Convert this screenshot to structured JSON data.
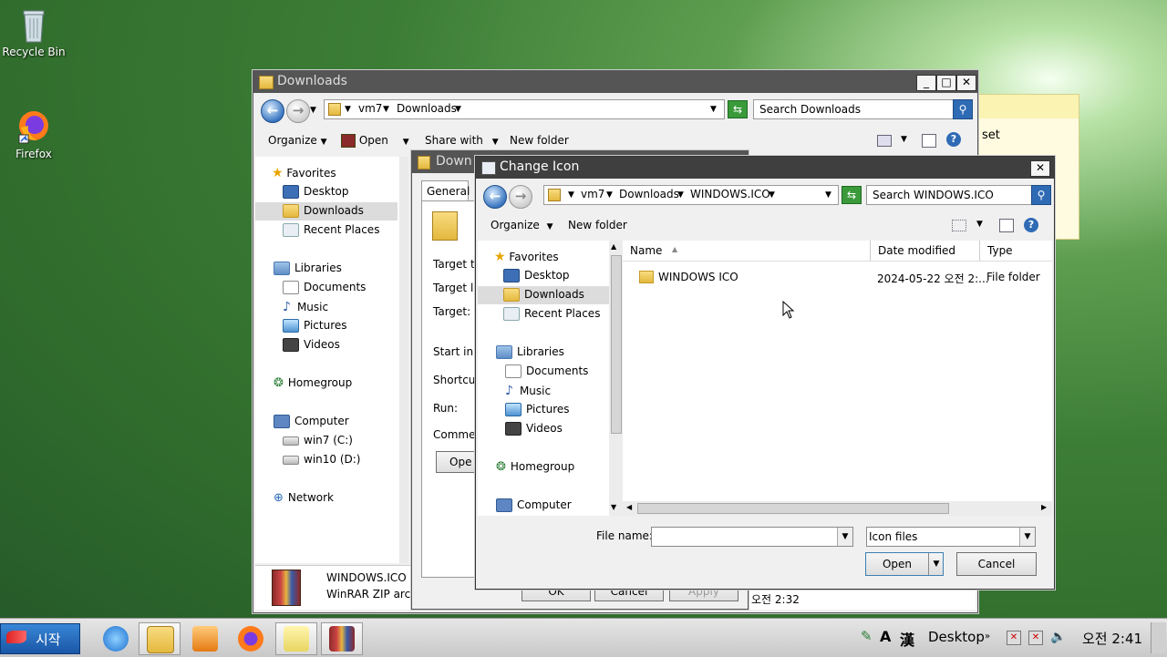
{
  "desktop": {
    "recycle_bin": "Recycle Bin",
    "firefox": "Firefox"
  },
  "sticky_note": {
    "text": "set"
  },
  "explorer": {
    "title": "Downloads",
    "breadcrumb": [
      "vm7",
      "Downloads"
    ],
    "search_placeholder": "Search Downloads",
    "toolbar": {
      "organize": "Organize",
      "open": "Open",
      "share_with": "Share with",
      "new_folder": "New folder"
    },
    "nav": {
      "favorites": "Favorites",
      "desktop": "Desktop",
      "downloads": "Downloads",
      "recent_places": "Recent Places",
      "libraries": "Libraries",
      "documents": "Documents",
      "music": "Music",
      "pictures": "Pictures",
      "videos": "Videos",
      "homegroup": "Homegroup",
      "computer": "Computer",
      "win7": "win7 (C:)",
      "win10": "win10 (D:)",
      "network": "Network"
    },
    "details": {
      "name": "WINDOWS.ICO",
      "type": "WinRAR ZIP archi"
    },
    "time_text": "오전 2:32"
  },
  "properties": {
    "title": "Down",
    "tab": "General",
    "labels": {
      "target_type": "Target ty",
      "target_location": "Target lo",
      "target": "Target:",
      "start_in": "Start in:",
      "shortcut": "Shortcut",
      "run": "Run:",
      "comment": "Commen"
    },
    "open_button": "Ope",
    "ok": "OK",
    "cancel": "Cancel",
    "apply": "Apply"
  },
  "change_icon": {
    "title": "Change Icon",
    "breadcrumb": [
      "vm7",
      "Downloads",
      "WINDOWS.ICO"
    ],
    "search_placeholder": "Search WINDOWS.ICO",
    "toolbar": {
      "organize": "Organize",
      "new_folder": "New folder"
    },
    "nav": {
      "favorites": "Favorites",
      "desktop": "Desktop",
      "downloads": "Downloads",
      "recent_places": "Recent Places",
      "libraries": "Libraries",
      "documents": "Documents",
      "music": "Music",
      "pictures": "Pictures",
      "videos": "Videos",
      "homegroup": "Homegroup",
      "computer": "Computer"
    },
    "columns": {
      "name": "Name",
      "date_modified": "Date modified",
      "type": "Type"
    },
    "rows": [
      {
        "name": "WINDOWS ICO",
        "date": "2024-05-22 오전 2:...",
        "type": "File folder"
      }
    ],
    "file_name_label": "File name:",
    "file_name_value": "",
    "file_type": "Icon files",
    "open_button": "Open",
    "cancel_button": "Cancel"
  },
  "taskbar": {
    "start": "시작",
    "desktop_label": "Desktop",
    "ime_a": "A",
    "ime_han": "漢",
    "clock": "오전 2:41"
  }
}
